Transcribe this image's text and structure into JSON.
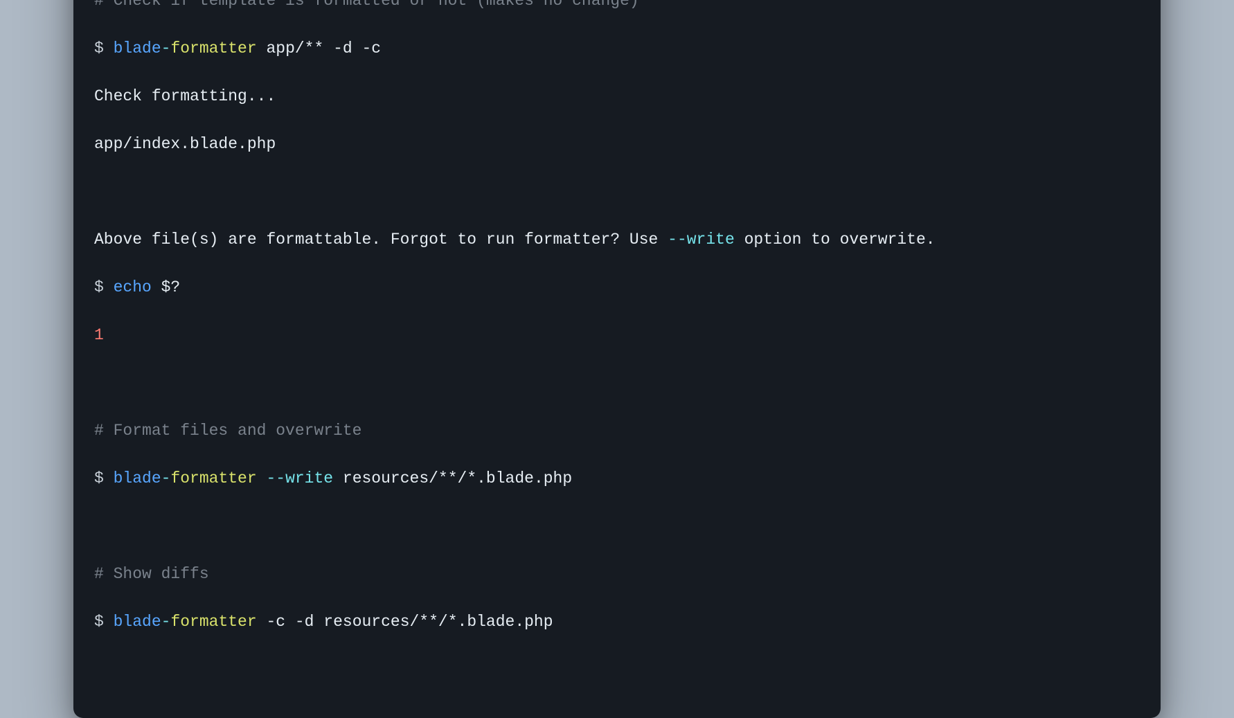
{
  "colors": {
    "background": "#aeb9c5",
    "terminal_bg": "#161b22",
    "comment": "#7a828c",
    "blue": "#58a6ff",
    "cyan": "#76e3ea",
    "yellow": "#d9e26b",
    "red": "#ff7b72",
    "text": "#c8d0d8"
  },
  "comment1": "# Check if template is formatted or not (makes no change)",
  "cmd1": {
    "prompt": "$ ",
    "part1": "blade",
    "dash": "-",
    "part2": "formatter ",
    "args": "app/** -d -c"
  },
  "out1_line1": "Check formatting...",
  "out1_line2": "app/index.blade.php",
  "out1_line3a": "Above file(s) are formattable. Forgot to run formatter? Use ",
  "out1_line3b": "--write",
  "out1_line3c": " option to overwrite.",
  "cmd2": {
    "prompt": "$ ",
    "echo": "echo",
    "arg": " $?"
  },
  "result1": "1",
  "comment2": "# Format files and overwrite",
  "cmd3": {
    "prompt": "$ ",
    "part1": "blade",
    "dash": "-",
    "part2": "formatter ",
    "flag": "--write",
    "args": " resources/**/*.blade.php"
  },
  "comment3": "# Show diffs",
  "cmd4": {
    "prompt": "$ ",
    "part1": "blade",
    "dash": "-",
    "part2": "formatter ",
    "args": "-c -d resources/**/*.blade.php"
  }
}
